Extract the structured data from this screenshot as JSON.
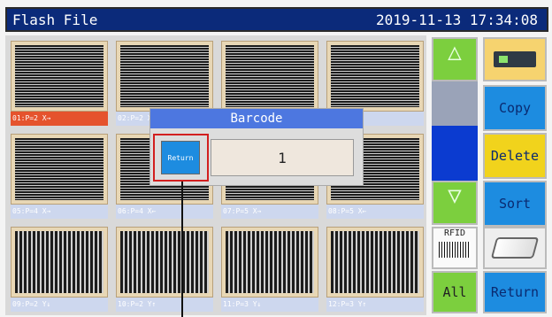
{
  "titlebar": {
    "title": "Flash File",
    "datetime": "2019-11-13 17:34:08"
  },
  "tiles": [
    {
      "caption": "01:P=2 X→",
      "pattern": "hstripes",
      "selected": true
    },
    {
      "caption": "02:P=2 X→",
      "pattern": "hstripes",
      "selected": false
    },
    {
      "caption": "",
      "pattern": "hstripes",
      "selected": false
    },
    {
      "caption": "X←",
      "pattern": "hstripes",
      "selected": false
    },
    {
      "caption": "05:P=4 X→",
      "pattern": "hstripes",
      "selected": false
    },
    {
      "caption": "06:P=4 X←",
      "pattern": "hstripes",
      "selected": false
    },
    {
      "caption": "07:P=5 X→",
      "pattern": "hstripes",
      "selected": false
    },
    {
      "caption": "08:P=5 X←",
      "pattern": "hstripes",
      "selected": false
    },
    {
      "caption": "09:P=2 Y↓",
      "pattern": "vstripes",
      "selected": false
    },
    {
      "caption": "10:P=2 Y↑",
      "pattern": "vstripes",
      "selected": false
    },
    {
      "caption": "11:P=3 Y↓",
      "pattern": "vstripes",
      "selected": false
    },
    {
      "caption": "12:P=3 Y↑",
      "pattern": "vstripes",
      "selected": false
    }
  ],
  "side": {
    "copy_label": "Copy",
    "delete_label": "Delete",
    "sort_label": "Sort",
    "return_label": "Return",
    "all_label": "All",
    "rfid_label": "RFID"
  },
  "dialog": {
    "title": "Barcode",
    "return_label": "Return",
    "value": "1"
  },
  "colors": {
    "accent": "#1d8ce0",
    "title_bar": "#0b2a7a",
    "selected": "#e5532d"
  }
}
